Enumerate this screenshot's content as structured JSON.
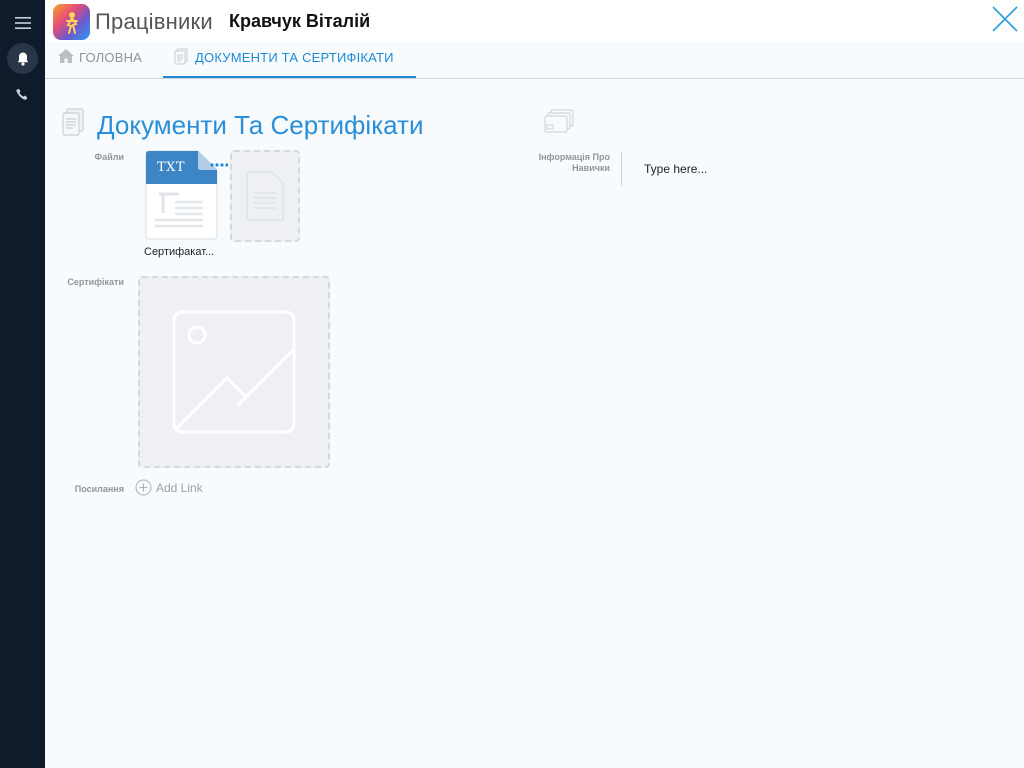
{
  "header": {
    "app_title": "Працівники",
    "record_title": "Кравчук Віталій"
  },
  "tabs": [
    {
      "label": "ГОЛОВНА",
      "active": false
    },
    {
      "label": "ДОКУМЕНТИ ТА СЕРТИФІКАТИ",
      "active": true
    }
  ],
  "section": {
    "title": "Документи Та Сертифікати"
  },
  "fields": {
    "files_label": "Файли",
    "certificates_label": "Сертифікати",
    "links_label": "Посилання",
    "skills_label_line1": "Інформація Про",
    "skills_label_line2": "Навички"
  },
  "file": {
    "type_badge": "TXT",
    "name": "Сертифакат..."
  },
  "add_link_label": "Add Link",
  "skills_input_placeholder": "Type here...",
  "colors": {
    "accent": "#1f8ad4",
    "rail": "#0f1a2b",
    "dropzone": "#eef0f3"
  }
}
